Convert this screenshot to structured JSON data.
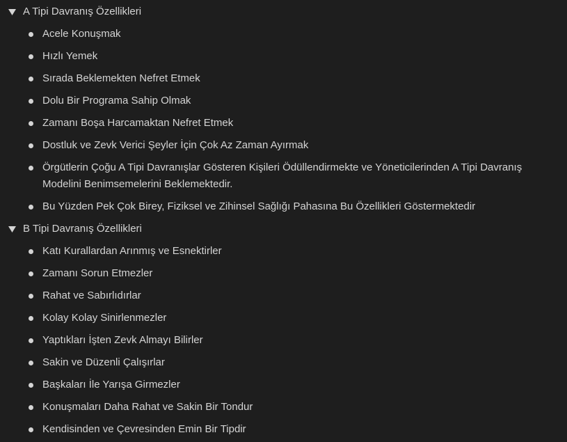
{
  "sections": [
    {
      "title": "A Tipi Davranış Özellikleri",
      "toggle_icon": "triangle-down-icon",
      "items": [
        "Acele Konuşmak",
        "Hızlı Yemek",
        "Sırada Beklemekten Nefret Etmek",
        "Dolu Bir Programa Sahip Olmak",
        "Zamanı Boşa Harcamaktan Nefret Etmek",
        "Dostluk ve Zevk Verici Şeyler İçin Çok Az Zaman Ayırmak",
        "Örgütlerin Çoğu A Tipi Davranışlar Gösteren Kişileri Ödüllendirmekte ve Yöneticilerinden A Tipi Davranış Modelini Benimsemelerini Beklemektedir.",
        "Bu Yüzden Pek Çok Birey, Fiziksel ve Zihinsel Sağlığı Pahasına Bu Özellikleri Göstermektedir"
      ]
    },
    {
      "title": "B Tipi Davranış Özellikleri",
      "toggle_icon": "triangle-down-icon",
      "items": [
        "Katı Kurallardan Arınmış ve Esnektirler",
        "Zamanı Sorun Etmezler",
        "Rahat ve Sabırlıdırlar",
        "Kolay Kolay Sinirlenmezler",
        "Yaptıkları İşten Zevk Almayı Bilirler",
        "Sakin ve Düzenli Çalışırlar",
        "Başkaları İle Yarışa Girmezler",
        "Konuşmaları Daha Rahat ve Sakin Bir Tondur",
        "Kendisinden ve Çevresinden Emin Bir Tipdir"
      ]
    }
  ],
  "colors": {
    "background": "#1e1e1e",
    "text": "#d4d4d4"
  }
}
